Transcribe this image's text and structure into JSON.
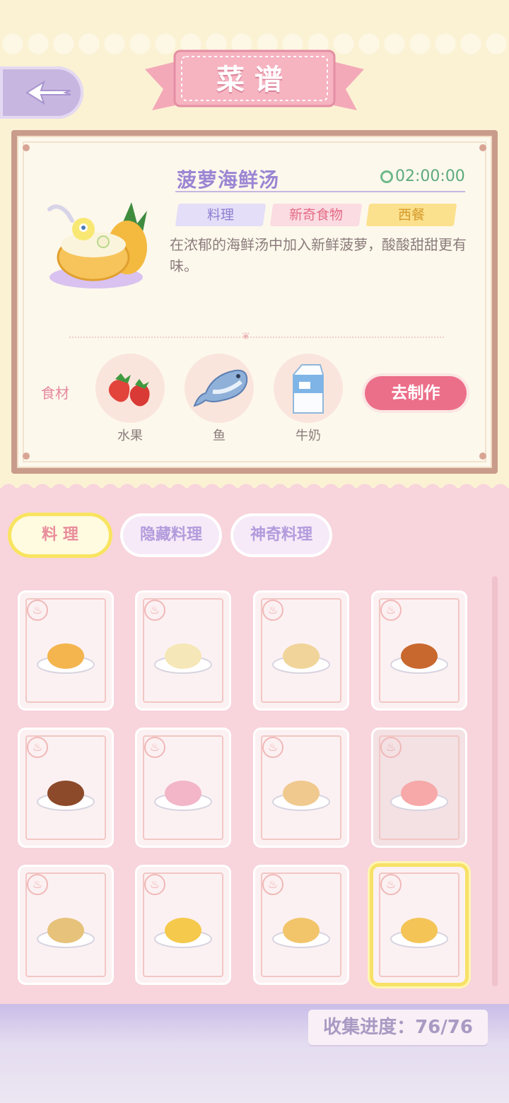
{
  "header": {
    "title": "菜谱"
  },
  "detail": {
    "name": "菠萝海鲜汤",
    "time": "02:00:00",
    "tags": [
      {
        "label": "料理",
        "color": "#e5def8",
        "text": "#8f7fd0"
      },
      {
        "label": "新奇食物",
        "color": "#fbdce2",
        "text": "#e46c86"
      },
      {
        "label": "西餐",
        "color": "#fbe08d",
        "text": "#d59a2a"
      }
    ],
    "description": "在浓郁的海鲜汤中加入新鲜菠萝，酸酸甜甜更有味。",
    "ingredients_label": "食材",
    "ingredients": [
      {
        "label": "水果",
        "icon": "strawberry-icon"
      },
      {
        "label": "鱼",
        "icon": "fish-icon"
      },
      {
        "label": "牛奶",
        "icon": "milk-carton-icon"
      }
    ],
    "make_button": "去制作"
  },
  "tabs": [
    {
      "label": "料 理",
      "active": true
    },
    {
      "label": "隐藏料理",
      "active": false
    },
    {
      "label": "神奇料理",
      "active": false
    }
  ],
  "recipes": [
    {
      "icon": "burger-plate-icon"
    },
    {
      "icon": "soup-bowl-icon"
    },
    {
      "icon": "stew-plate-icon"
    },
    {
      "icon": "fried-chicken-icon"
    },
    {
      "icon": "clay-pot-icon"
    },
    {
      "icon": "dango-icon"
    },
    {
      "icon": "dim-sum-icon"
    },
    {
      "icon": "parfait-icon"
    },
    {
      "icon": "cookies-icon"
    },
    {
      "icon": "toast-icon"
    },
    {
      "icon": "bun-box-icon"
    },
    {
      "icon": "pineapple-soup-icon"
    }
  ],
  "progress": "收集进度：76/76",
  "colors": {
    "accent_pink": "#ec6f8a",
    "accent_purple": "#9a86d3",
    "selected": "#f7e166"
  }
}
